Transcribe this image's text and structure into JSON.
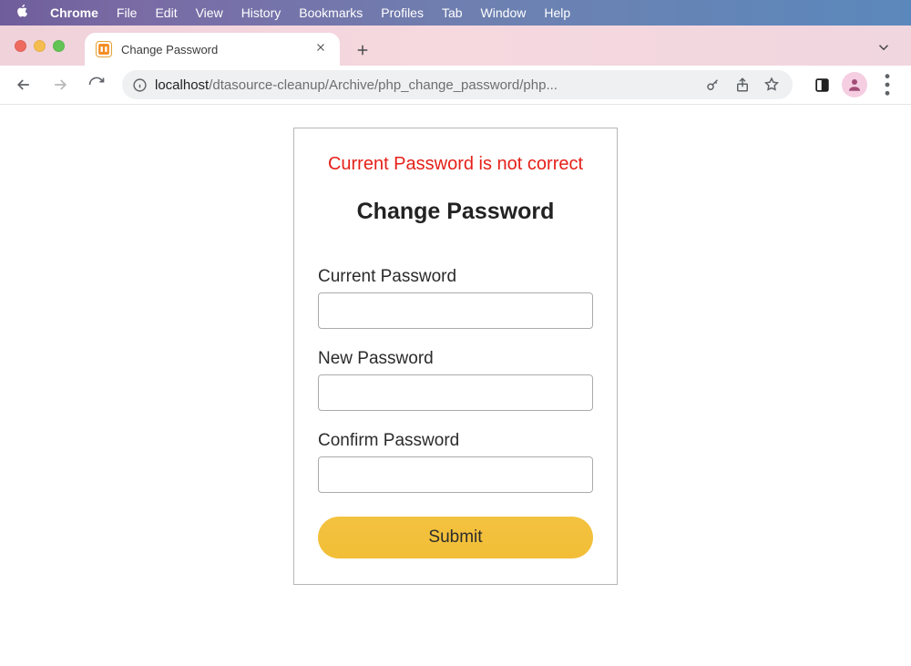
{
  "menubar": {
    "app": "Chrome",
    "items": [
      "File",
      "Edit",
      "View",
      "History",
      "Bookmarks",
      "Profiles",
      "Tab",
      "Window",
      "Help"
    ]
  },
  "browser": {
    "tab_title": "Change Password",
    "url_host": "localhost",
    "url_path": "/dtasource-cleanup/Archive/php_change_password/php..."
  },
  "page": {
    "error": "Current Password is not correct",
    "title": "Change Password",
    "fields": {
      "current": {
        "label": "Current Password",
        "value": ""
      },
      "new": {
        "label": "New Password",
        "value": ""
      },
      "confirm": {
        "label": "Confirm Password",
        "value": ""
      }
    },
    "submit_label": "Submit"
  },
  "icons": {
    "apple": "apple-icon",
    "close_tab": "close-icon",
    "new_tab": "plus-icon",
    "tab_dropdown": "chevron-down-icon",
    "back": "arrow-left-icon",
    "forward": "arrow-right-icon",
    "reload": "reload-icon",
    "site_info": "info-icon",
    "key": "key-icon",
    "share": "share-icon",
    "star": "star-icon",
    "extensions": "incognito-box-icon",
    "profile": "person-icon",
    "kebab": "more-vertical-icon"
  }
}
